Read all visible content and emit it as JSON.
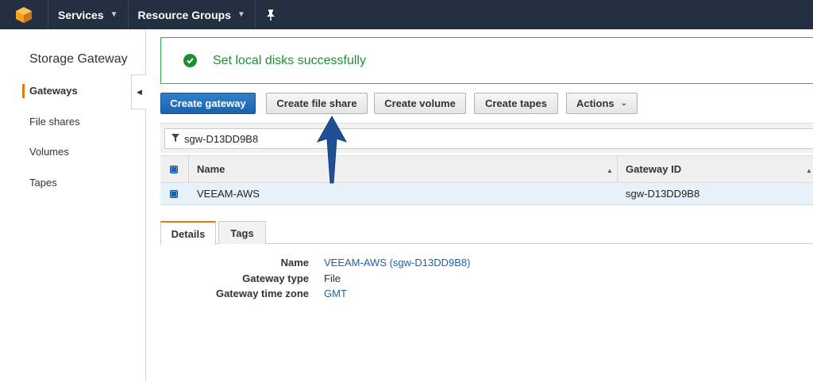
{
  "topnav": {
    "services_label": "Services",
    "resource_groups_label": "Resource Groups"
  },
  "sidebar": {
    "title": "Storage Gateway",
    "items": [
      {
        "label": "Gateways"
      },
      {
        "label": "File shares"
      },
      {
        "label": "Volumes"
      },
      {
        "label": "Tapes"
      }
    ]
  },
  "flash": {
    "message": "Set local disks successfully"
  },
  "toolbar": {
    "create_gateway": "Create gateway",
    "create_file_share": "Create file share",
    "create_volume": "Create volume",
    "create_tapes": "Create tapes",
    "actions": "Actions"
  },
  "filter": {
    "value": "sgw-D13DD9B8"
  },
  "table": {
    "headers": {
      "name": "Name",
      "gateway_id": "Gateway ID"
    },
    "rows": [
      {
        "name": "VEEAM-AWS",
        "gateway_id": "sgw-D13DD9B8"
      }
    ]
  },
  "tabs": {
    "details": "Details",
    "tags": "Tags"
  },
  "details": {
    "name_label": "Name",
    "name_value": "VEEAM-AWS (sgw-D13DD9B8)",
    "type_label": "Gateway type",
    "type_value": "File",
    "tz_label": "Gateway time zone",
    "tz_value": "GMT"
  },
  "colors": {
    "nav_bg": "#232f3e",
    "primary": "#1a63ad",
    "success": "#1e8f30",
    "accent": "#e47911"
  }
}
